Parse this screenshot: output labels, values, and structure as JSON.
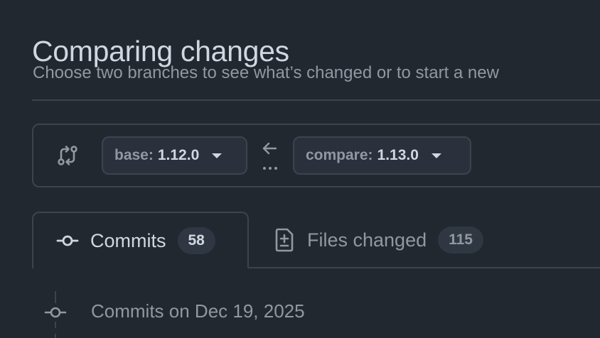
{
  "header": {
    "title": "Comparing changes",
    "subtitle": "Choose two branches to see what’s changed or to start a new"
  },
  "range": {
    "icon": "git-compare-icon",
    "base": {
      "label": "base:",
      "value": "1.12.0"
    },
    "arrow_icon": "arrow-left-icon",
    "compare": {
      "label": "compare:",
      "value": "1.13.0"
    }
  },
  "tabs": [
    {
      "icon": "git-commit-icon",
      "label": "Commits",
      "count": "58",
      "selected": true
    },
    {
      "icon": "file-diff-icon",
      "label": "Files changed",
      "count": "115",
      "selected": false
    }
  ],
  "timeline": {
    "icon": "git-commit-icon",
    "heading": "Commits on Dec 19, 2025"
  },
  "colors": {
    "background": "#212830",
    "border": "#3d444d",
    "text_primary": "#d1d7e0",
    "text_muted": "#9198a1",
    "button_bg": "#2a313c"
  }
}
